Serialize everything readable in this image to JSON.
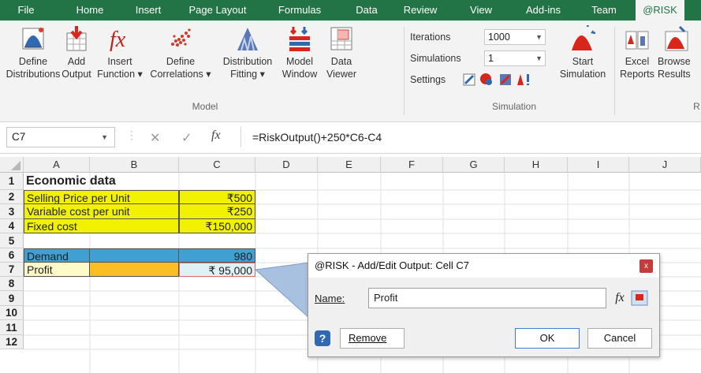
{
  "tabs": [
    "File",
    "Home",
    "Insert",
    "Page Layout",
    "Formulas",
    "Data",
    "Review",
    "View",
    "Add-ins",
    "Team",
    "@RISK"
  ],
  "ribbon": {
    "model": {
      "define_distributions": [
        "Define",
        "Distributions"
      ],
      "add_output": [
        "Add",
        "Output"
      ],
      "insert_function": [
        "Insert",
        "Function ▾"
      ],
      "define_correlations": [
        "Define",
        "Correlations ▾"
      ],
      "distribution_fitting": [
        "Distribution",
        "Fitting ▾"
      ],
      "model_window": [
        "Model",
        "Window"
      ],
      "data_viewer": [
        "Data",
        "Viewer"
      ],
      "group_label": "Model"
    },
    "simulation": {
      "iterations_label": "Iterations",
      "iterations_value": "1000",
      "simulations_label": "Simulations",
      "simulations_value": "1",
      "settings_label": "Settings",
      "start_simulation": [
        "Start",
        "Simulation"
      ],
      "group_label": "Simulation"
    },
    "reports": {
      "excel_reports": [
        "Excel",
        "Reports"
      ],
      "browse_results": [
        "Browse",
        "Results"
      ],
      "group_label_partial": "R"
    }
  },
  "formula_bar": {
    "name_box": "C7",
    "cancel_glyph": "✕",
    "enter_glyph": "✓",
    "fx_glyph": "fx",
    "formula": "=RiskOutput()+250*C6-C4"
  },
  "grid": {
    "columns": [
      "A",
      "B",
      "C",
      "D",
      "E",
      "F",
      "G",
      "H",
      "I",
      "J"
    ],
    "rows": [
      "1",
      "2",
      "3",
      "4",
      "5",
      "6",
      "7",
      "8",
      "9",
      "10",
      "11",
      "12"
    ],
    "cells": {
      "A1": "Economic data",
      "A2": "Selling Price per Unit",
      "C2": "₹500",
      "A3": "Variable cost per unit",
      "C3": "₹250",
      "A4": "Fixed cost",
      "C4": "₹150,000",
      "A6": "Demand",
      "C6": "980",
      "A7": "Profit",
      "C7": "₹ 95,000"
    },
    "colors": {
      "yellow": "#f2f200",
      "blue": "#3fa0d1",
      "orange": "#fbbf24",
      "cream": "#fffbc9",
      "selected": "#dff1f5"
    }
  },
  "dialog": {
    "title": "@RISK - Add/Edit Output: Cell C7",
    "close_glyph": "x",
    "name_label": "Name:",
    "name_value": "Profit",
    "fx_glyph": "fx",
    "remove": "Remove",
    "ok": "OK",
    "cancel": "Cancel"
  },
  "accent": "#227447"
}
